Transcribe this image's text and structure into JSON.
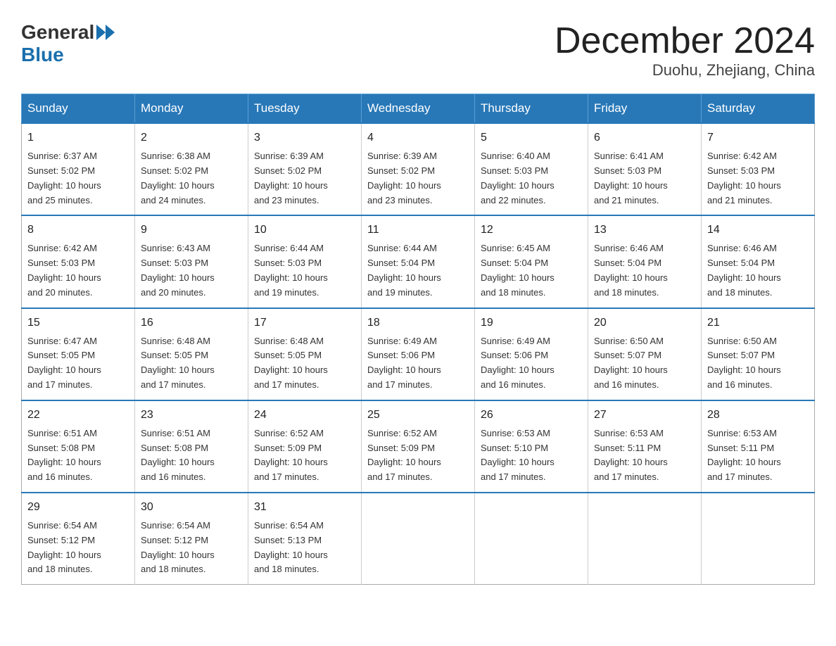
{
  "header": {
    "logo_general": "General",
    "logo_blue": "Blue",
    "title": "December 2024",
    "location": "Duohu, Zhejiang, China"
  },
  "days_of_week": [
    "Sunday",
    "Monday",
    "Tuesday",
    "Wednesday",
    "Thursday",
    "Friday",
    "Saturday"
  ],
  "weeks": [
    [
      {
        "day": "1",
        "sunrise": "6:37 AM",
        "sunset": "5:02 PM",
        "daylight": "10 hours and 25 minutes."
      },
      {
        "day": "2",
        "sunrise": "6:38 AM",
        "sunset": "5:02 PM",
        "daylight": "10 hours and 24 minutes."
      },
      {
        "day": "3",
        "sunrise": "6:39 AM",
        "sunset": "5:02 PM",
        "daylight": "10 hours and 23 minutes."
      },
      {
        "day": "4",
        "sunrise": "6:39 AM",
        "sunset": "5:02 PM",
        "daylight": "10 hours and 23 minutes."
      },
      {
        "day": "5",
        "sunrise": "6:40 AM",
        "sunset": "5:03 PM",
        "daylight": "10 hours and 22 minutes."
      },
      {
        "day": "6",
        "sunrise": "6:41 AM",
        "sunset": "5:03 PM",
        "daylight": "10 hours and 21 minutes."
      },
      {
        "day": "7",
        "sunrise": "6:42 AM",
        "sunset": "5:03 PM",
        "daylight": "10 hours and 21 minutes."
      }
    ],
    [
      {
        "day": "8",
        "sunrise": "6:42 AM",
        "sunset": "5:03 PM",
        "daylight": "10 hours and 20 minutes."
      },
      {
        "day": "9",
        "sunrise": "6:43 AM",
        "sunset": "5:03 PM",
        "daylight": "10 hours and 20 minutes."
      },
      {
        "day": "10",
        "sunrise": "6:44 AM",
        "sunset": "5:03 PM",
        "daylight": "10 hours and 19 minutes."
      },
      {
        "day": "11",
        "sunrise": "6:44 AM",
        "sunset": "5:04 PM",
        "daylight": "10 hours and 19 minutes."
      },
      {
        "day": "12",
        "sunrise": "6:45 AM",
        "sunset": "5:04 PM",
        "daylight": "10 hours and 18 minutes."
      },
      {
        "day": "13",
        "sunrise": "6:46 AM",
        "sunset": "5:04 PM",
        "daylight": "10 hours and 18 minutes."
      },
      {
        "day": "14",
        "sunrise": "6:46 AM",
        "sunset": "5:04 PM",
        "daylight": "10 hours and 18 minutes."
      }
    ],
    [
      {
        "day": "15",
        "sunrise": "6:47 AM",
        "sunset": "5:05 PM",
        "daylight": "10 hours and 17 minutes."
      },
      {
        "day": "16",
        "sunrise": "6:48 AM",
        "sunset": "5:05 PM",
        "daylight": "10 hours and 17 minutes."
      },
      {
        "day": "17",
        "sunrise": "6:48 AM",
        "sunset": "5:05 PM",
        "daylight": "10 hours and 17 minutes."
      },
      {
        "day": "18",
        "sunrise": "6:49 AM",
        "sunset": "5:06 PM",
        "daylight": "10 hours and 17 minutes."
      },
      {
        "day": "19",
        "sunrise": "6:49 AM",
        "sunset": "5:06 PM",
        "daylight": "10 hours and 16 minutes."
      },
      {
        "day": "20",
        "sunrise": "6:50 AM",
        "sunset": "5:07 PM",
        "daylight": "10 hours and 16 minutes."
      },
      {
        "day": "21",
        "sunrise": "6:50 AM",
        "sunset": "5:07 PM",
        "daylight": "10 hours and 16 minutes."
      }
    ],
    [
      {
        "day": "22",
        "sunrise": "6:51 AM",
        "sunset": "5:08 PM",
        "daylight": "10 hours and 16 minutes."
      },
      {
        "day": "23",
        "sunrise": "6:51 AM",
        "sunset": "5:08 PM",
        "daylight": "10 hours and 16 minutes."
      },
      {
        "day": "24",
        "sunrise": "6:52 AM",
        "sunset": "5:09 PM",
        "daylight": "10 hours and 17 minutes."
      },
      {
        "day": "25",
        "sunrise": "6:52 AM",
        "sunset": "5:09 PM",
        "daylight": "10 hours and 17 minutes."
      },
      {
        "day": "26",
        "sunrise": "6:53 AM",
        "sunset": "5:10 PM",
        "daylight": "10 hours and 17 minutes."
      },
      {
        "day": "27",
        "sunrise": "6:53 AM",
        "sunset": "5:11 PM",
        "daylight": "10 hours and 17 minutes."
      },
      {
        "day": "28",
        "sunrise": "6:53 AM",
        "sunset": "5:11 PM",
        "daylight": "10 hours and 17 minutes."
      }
    ],
    [
      {
        "day": "29",
        "sunrise": "6:54 AM",
        "sunset": "5:12 PM",
        "daylight": "10 hours and 18 minutes."
      },
      {
        "day": "30",
        "sunrise": "6:54 AM",
        "sunset": "5:12 PM",
        "daylight": "10 hours and 18 minutes."
      },
      {
        "day": "31",
        "sunrise": "6:54 AM",
        "sunset": "5:13 PM",
        "daylight": "10 hours and 18 minutes."
      },
      null,
      null,
      null,
      null
    ]
  ],
  "labels": {
    "sunrise": "Sunrise:",
    "sunset": "Sunset:",
    "daylight": "Daylight:"
  }
}
